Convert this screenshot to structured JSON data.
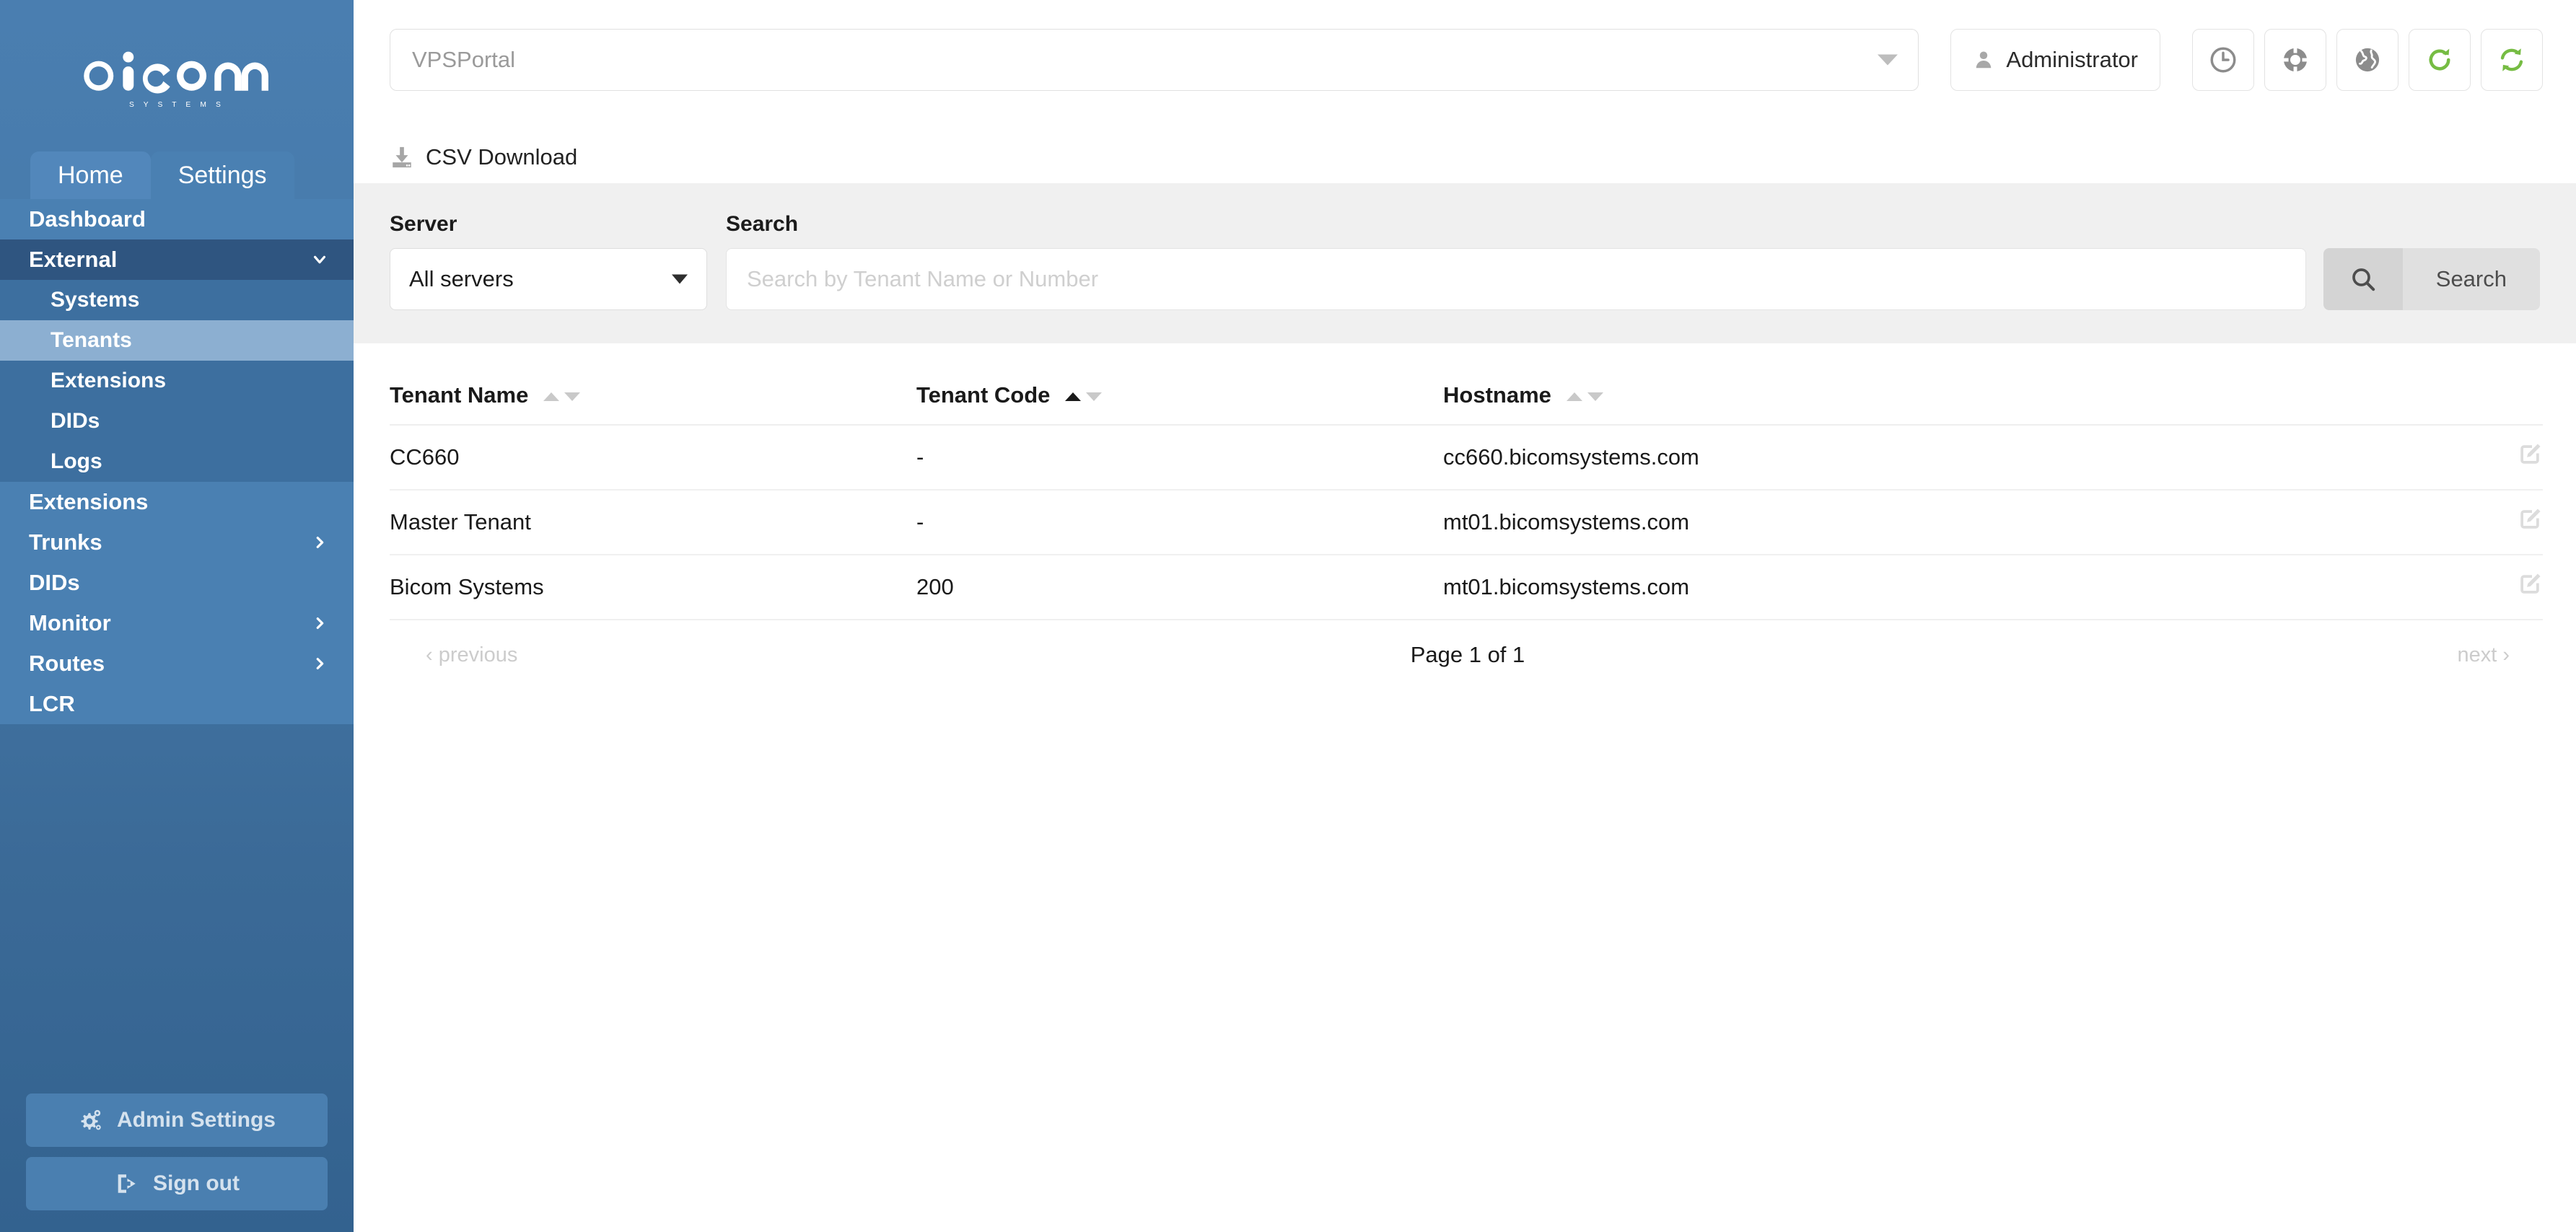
{
  "brand": {
    "name": "bicom",
    "tagline": "S Y S T E M S",
    "sidebar_color": "#4a7eb0",
    "accent_green": "#76bc43"
  },
  "sidebar": {
    "tabs": [
      {
        "label": "Home",
        "active": true
      },
      {
        "label": "Settings",
        "active": false
      }
    ],
    "items": [
      {
        "label": "Dashboard",
        "level": 0,
        "state": "plain"
      },
      {
        "label": "External",
        "level": 0,
        "state": "expanded",
        "chevron": "chevron-down"
      },
      {
        "label": "Systems",
        "level": 1,
        "state": "sub"
      },
      {
        "label": "Tenants",
        "level": 1,
        "state": "sub-active"
      },
      {
        "label": "Extensions",
        "level": 1,
        "state": "sub"
      },
      {
        "label": "DIDs",
        "level": 1,
        "state": "sub"
      },
      {
        "label": "Logs",
        "level": 1,
        "state": "sub"
      },
      {
        "label": "Extensions",
        "level": 0,
        "state": "plain"
      },
      {
        "label": "Trunks",
        "level": 0,
        "state": "plain",
        "chevron": "chevron-right"
      },
      {
        "label": "DIDs",
        "level": 0,
        "state": "plain"
      },
      {
        "label": "Monitor",
        "level": 0,
        "state": "plain",
        "chevron": "chevron-right"
      },
      {
        "label": "Routes",
        "level": 0,
        "state": "plain",
        "chevron": "chevron-right"
      },
      {
        "label": "LCR",
        "level": 0,
        "state": "plain"
      }
    ],
    "admin_settings_label": "Admin Settings",
    "sign_out_label": "Sign out"
  },
  "topbar": {
    "portal_value": "VPSPortal",
    "user_label": "Administrator",
    "icon_buttons": [
      {
        "name": "clock-icon",
        "color": "#8c8c8c"
      },
      {
        "name": "life-ring-icon",
        "color": "#8c8c8c"
      },
      {
        "name": "globe-icon",
        "color": "#8c8c8c"
      },
      {
        "name": "refresh-icon",
        "color": "#76bc43"
      },
      {
        "name": "sync-icon",
        "color": "#76bc43"
      }
    ]
  },
  "toolbar": {
    "csv_download_label": "CSV Download"
  },
  "filters": {
    "server_label": "Server",
    "server_value": "All servers",
    "search_label": "Search",
    "search_value": "",
    "search_placeholder": "Search by Tenant Name or Number",
    "search_button_label": "Search"
  },
  "table": {
    "columns": [
      {
        "label": "Tenant Name",
        "sort": "none"
      },
      {
        "label": "Tenant Code",
        "sort": "asc"
      },
      {
        "label": "Hostname",
        "sort": "none"
      }
    ],
    "rows": [
      {
        "tenant_name": "CC660",
        "tenant_code": "-",
        "hostname": "cc660.bicomsystems.com",
        "action": "edit-icon"
      },
      {
        "tenant_name": "Master Tenant",
        "tenant_code": "-",
        "hostname": "mt01.bicomsystems.com",
        "action": "edit-icon"
      },
      {
        "tenant_name": "Bicom Systems",
        "tenant_code": "200",
        "hostname": "mt01.bicomsystems.com",
        "action": "edit-icon"
      }
    ]
  },
  "pagination": {
    "previous_label": "‹ previous",
    "page_label": "Page 1 of 1",
    "next_label": "next ›"
  }
}
